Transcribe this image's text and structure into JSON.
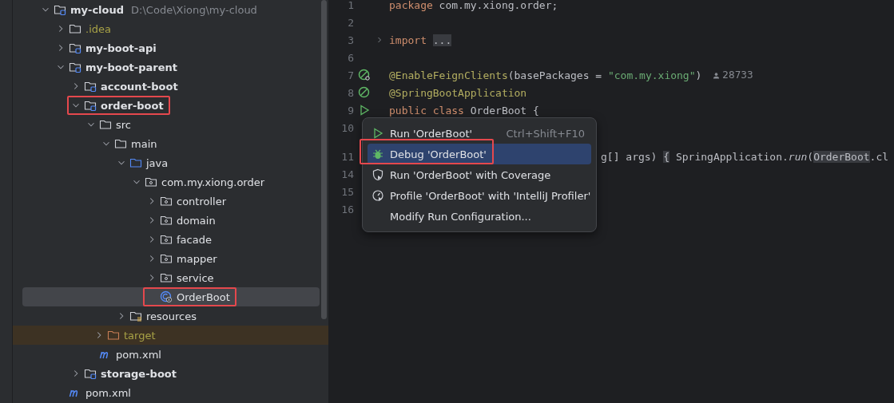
{
  "project_tree": [
    {
      "name": "my-cloud",
      "kind": "module",
      "path": "D:\\Code\\Xiong\\my-cloud",
      "expanded": true,
      "selected": false,
      "annotated": false,
      "children": [
        {
          "name": ".idea",
          "kind": "ignored",
          "expanded": false,
          "selected": false,
          "annotated": false
        },
        {
          "name": "my-boot-api",
          "kind": "module",
          "expanded": false,
          "selected": false,
          "annotated": false
        },
        {
          "name": "my-boot-parent",
          "kind": "module",
          "expanded": true,
          "selected": false,
          "annotated": false,
          "children": [
            {
              "name": "account-boot",
              "kind": "module",
              "expanded": false,
              "selected": false,
              "annotated": false
            },
            {
              "name": "order-boot",
              "kind": "module",
              "expanded": true,
              "selected": false,
              "annotated": true,
              "children": [
                {
                  "name": "src",
                  "kind": "folder",
                  "expanded": true,
                  "selected": false,
                  "annotated": false,
                  "children": [
                    {
                      "name": "main",
                      "kind": "folder",
                      "expanded": true,
                      "selected": false,
                      "annotated": false,
                      "children": [
                        {
                          "name": "java",
                          "kind": "source",
                          "expanded": true,
                          "selected": false,
                          "annotated": false,
                          "children": [
                            {
                              "name": "com.my.xiong.order",
                              "kind": "package",
                              "expanded": true,
                              "selected": false,
                              "annotated": false,
                              "children": [
                                {
                                  "name": "controller",
                                  "kind": "package",
                                  "expanded": false,
                                  "selected": false,
                                  "annotated": false
                                },
                                {
                                  "name": "domain",
                                  "kind": "package",
                                  "expanded": false,
                                  "selected": false,
                                  "annotated": false
                                },
                                {
                                  "name": "facade",
                                  "kind": "package",
                                  "expanded": false,
                                  "selected": false,
                                  "annotated": false
                                },
                                {
                                  "name": "mapper",
                                  "kind": "package",
                                  "expanded": false,
                                  "selected": false,
                                  "annotated": false
                                },
                                {
                                  "name": "service",
                                  "kind": "package",
                                  "expanded": false,
                                  "selected": false,
                                  "annotated": false
                                },
                                {
                                  "name": "OrderBoot",
                                  "kind": "class",
                                  "selected": true,
                                  "annotated": true
                                }
                              ]
                            }
                          ]
                        },
                        {
                          "name": "resources",
                          "kind": "resources",
                          "expanded": false,
                          "selected": false,
                          "annotated": false
                        }
                      ]
                    }
                  ]
                },
                {
                  "name": "target",
                  "kind": "excluded",
                  "expanded": false,
                  "selected": false,
                  "annotated": false
                },
                {
                  "name": "pom.xml",
                  "kind": "maven",
                  "selected": false,
                  "annotated": false
                }
              ]
            },
            {
              "name": "storage-boot",
              "kind": "module",
              "expanded": false,
              "selected": false,
              "annotated": false
            }
          ]
        },
        {
          "name": "pom.xml",
          "kind": "maven",
          "selected": false,
          "annotated": false
        }
      ]
    }
  ],
  "editor": {
    "lines": [
      {
        "number": "1",
        "kind": "code",
        "tokens": [
          {
            "kind": "keyword",
            "text": "package"
          },
          {
            "kind": "plain",
            "text": " com.my.xiong.order;"
          }
        ]
      },
      {
        "number": "2",
        "kind": "code"
      },
      {
        "number": "3",
        "kind": "code",
        "fold": true,
        "tokens": [
          {
            "kind": "keyword",
            "text": "import "
          },
          {
            "kind": "folded",
            "text": "..."
          }
        ]
      },
      {
        "number": "6",
        "kind": "code"
      },
      {
        "number": "7",
        "kind": "bean-search",
        "tokens": [
          {
            "kind": "annotation",
            "text": "@EnableFeignClients"
          },
          {
            "kind": "plain",
            "text": "(basePackages = "
          },
          {
            "kind": "string",
            "text": "\"com.my.xiong\""
          },
          {
            "kind": "plain",
            "text": ")"
          }
        ],
        "hint": "28733"
      },
      {
        "number": "8",
        "kind": "bean",
        "tokens": [
          {
            "kind": "annotation",
            "text": "@SpringBootApplication"
          }
        ]
      },
      {
        "number": "9",
        "kind": "run",
        "tokens": [
          {
            "kind": "keyword",
            "text": "public class "
          },
          {
            "kind": "plain",
            "text": "OrderBoot {"
          }
        ]
      },
      {
        "number": "10",
        "kind": "code"
      },
      {
        "number": "11",
        "kind": "code",
        "covered": true,
        "tokens": [
          {
            "kind": "plain",
            "text": "g[] args) "
          },
          {
            "kind": "folded",
            "text": "{"
          },
          {
            "kind": "plain",
            "text": " SpringApplication."
          },
          {
            "kind": "call",
            "text": "run"
          },
          {
            "kind": "plain",
            "text": "("
          },
          {
            "kind": "folded",
            "text": "OrderBoot"
          },
          {
            "kind": "plain",
            "text": ".cl"
          }
        ]
      },
      {
        "number": "14",
        "kind": "code"
      },
      {
        "number": "15",
        "kind": "code"
      },
      {
        "number": "16",
        "kind": "code"
      }
    ]
  },
  "context_menu": {
    "items": [
      {
        "kind": "run",
        "label": "Run 'OrderBoot'",
        "shortcut": "Ctrl+Shift+F10",
        "selected": false,
        "annotated": false
      },
      {
        "kind": "debug",
        "label": "Debug 'OrderBoot'",
        "selected": true,
        "annotated": true
      },
      {
        "kind": "coverage",
        "label": "Run 'OrderBoot' with Coverage",
        "selected": false,
        "annotated": false
      },
      {
        "kind": "profile",
        "label": "Profile 'OrderBoot' with 'IntelliJ Profiler'",
        "selected": false,
        "annotated": false
      },
      {
        "kind": "plain",
        "label": "Modify Run Configuration...",
        "selected": false,
        "annotated": false
      }
    ]
  }
}
